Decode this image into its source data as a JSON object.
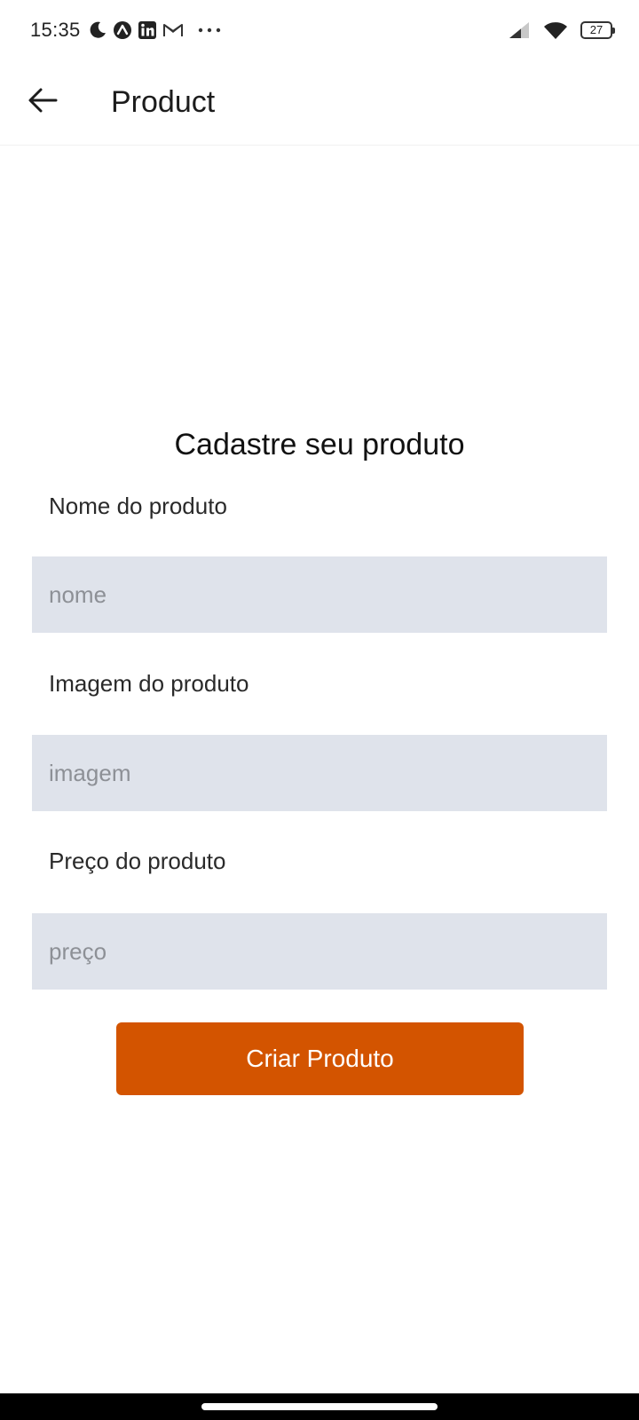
{
  "status_bar": {
    "time": "15:35",
    "notification_icons": [
      "moon-icon",
      "arc-app-icon",
      "linkedin-icon",
      "gmail-icon",
      "more-dots-icon"
    ],
    "battery_level": "27",
    "signal_icon": "cellular-signal-icon",
    "wifi_icon": "wifi-icon"
  },
  "app_bar": {
    "title": "Product",
    "back_icon": "arrow-left-icon"
  },
  "form": {
    "title": "Cadastre seu produto",
    "fields": [
      {
        "label": "Nome do produto",
        "placeholder": "nome",
        "value": ""
      },
      {
        "label": "Imagem do produto",
        "placeholder": "imagem",
        "value": ""
      },
      {
        "label": "Preço do produto",
        "placeholder": "preço",
        "value": ""
      }
    ],
    "submit_label": "Criar Produto"
  },
  "colors": {
    "accent": "#d35400",
    "input_background": "#dfe3eb",
    "background": "#ffffff"
  }
}
